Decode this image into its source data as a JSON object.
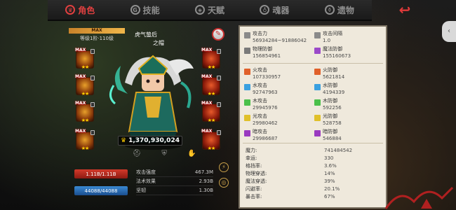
{
  "nav": {
    "tabs": [
      {
        "label": "角色",
        "icon": "crown-icon",
        "active": true
      },
      {
        "label": "技能",
        "icon": "skill-icon",
        "active": false
      },
      {
        "label": "天赋",
        "icon": "talent-icon",
        "active": false
      },
      {
        "label": "魂器",
        "icon": "soul-icon",
        "active": false
      },
      {
        "label": "遗物",
        "icon": "relic-icon",
        "active": false
      }
    ],
    "back_icon": "back-arrow-icon"
  },
  "hero": {
    "banner": "MAX",
    "level_text": "等级1阶·110级",
    "name": "虎气蛰后",
    "subname": "之帽",
    "power": "1,370,930,024",
    "hp": "1.11B/1.11B",
    "mp": "44088/44088"
  },
  "slots_left": [
    {
      "max": "MAX",
      "stars": "★★"
    },
    {
      "max": "MAX",
      "stars": "★★"
    },
    {
      "max": "MAX",
      "stars": "★★"
    },
    {
      "max": "MAX",
      "stars": "★★"
    }
  ],
  "slots_right": [
    {
      "max": "MAX",
      "stars": "★★"
    },
    {
      "max": "MAX",
      "stars": "★★"
    },
    {
      "max": "MAX",
      "stars": "★★"
    },
    {
      "max": "MAX",
      "stars": "★★"
    }
  ],
  "mini_stats": [
    {
      "label": "攻击强度",
      "value": "467.3M"
    },
    {
      "label": "法术效果",
      "value": "2.93B"
    },
    {
      "label": "坚韧",
      "value": "1.30B"
    }
  ],
  "stats": [
    [
      {
        "label": "攻击力",
        "value": "56934284~91886042",
        "color": "#8a8a8a"
      },
      {
        "label": "攻击间隔",
        "value": "1.0",
        "color": "#8a8a8a"
      }
    ],
    [
      {
        "label": "物理防御",
        "value": "156854961",
        "color": "#7a7a7a"
      },
      {
        "label": "魔法防御",
        "value": "155160673",
        "color": "#9b4ac9"
      }
    ],
    [
      {
        "label": "火攻击",
        "value": "107330957",
        "color": "#e0602a"
      },
      {
        "label": "火防御",
        "value": "5621814",
        "color": "#e0602a"
      }
    ],
    [
      {
        "label": "水攻击",
        "value": "92747963",
        "color": "#3aa0e0"
      },
      {
        "label": "水防御",
        "value": "4194339",
        "color": "#3aa0e0"
      }
    ],
    [
      {
        "label": "木攻击",
        "value": "29945976",
        "color": "#4ac04a"
      },
      {
        "label": "木防御",
        "value": "592256",
        "color": "#4ac04a"
      }
    ],
    [
      {
        "label": "光攻击",
        "value": "29980462",
        "color": "#e0c02a"
      },
      {
        "label": "光防御",
        "value": "528758",
        "color": "#e0c02a"
      }
    ],
    [
      {
        "label": "暗攻击",
        "value": "29986687",
        "color": "#9a3ac0"
      },
      {
        "label": "暗防御",
        "value": "546884",
        "color": "#9a3ac0"
      }
    ]
  ],
  "bottom_stats": [
    {
      "label": "魔力:",
      "value": "741484542"
    },
    {
      "label": "幸运:",
      "value": "330"
    },
    {
      "label": "格挡率:",
      "value": "3.6%"
    },
    {
      "label": "物理穿透:",
      "value": "14%"
    },
    {
      "label": "魔法穿透:",
      "value": "39%"
    },
    {
      "label": "闪避率:",
      "value": "20.1%"
    },
    {
      "label": "暴击率:",
      "value": "67%"
    }
  ]
}
